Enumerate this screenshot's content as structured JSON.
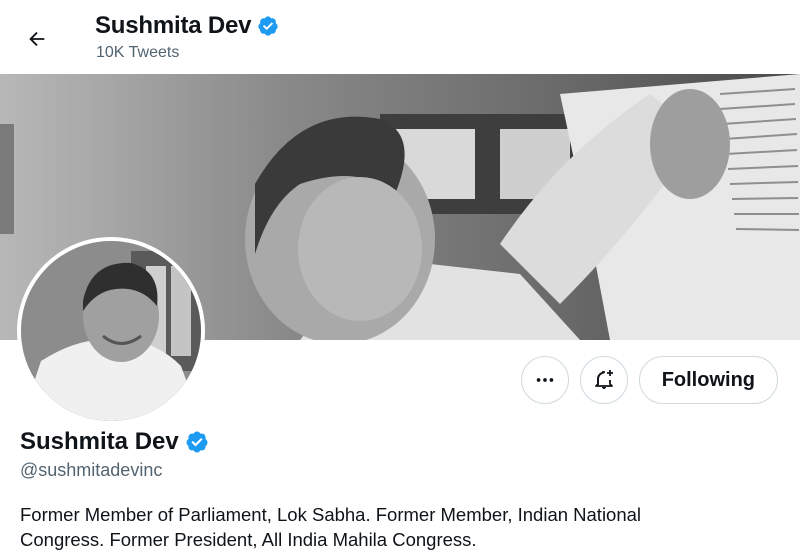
{
  "header": {
    "name": "Sushmita Dev",
    "tweet_count": "10K Tweets"
  },
  "profile": {
    "name": "Sushmita Dev",
    "handle": "@sushmitadevinc",
    "verified": true,
    "bio_line1": "Former Member of Parliament, Lok Sabha. Former Member, Indian National",
    "bio_line2": "Congress. Former President, All India Mahila Congress."
  },
  "actions": {
    "more_icon": "more-horizontal-icon",
    "notify_icon": "bell-plus-icon",
    "follow_label": "Following"
  },
  "colors": {
    "verified": "#1d9bf0",
    "text": "#0f1419",
    "secondary": "#536471",
    "border": "#cfd9de"
  }
}
